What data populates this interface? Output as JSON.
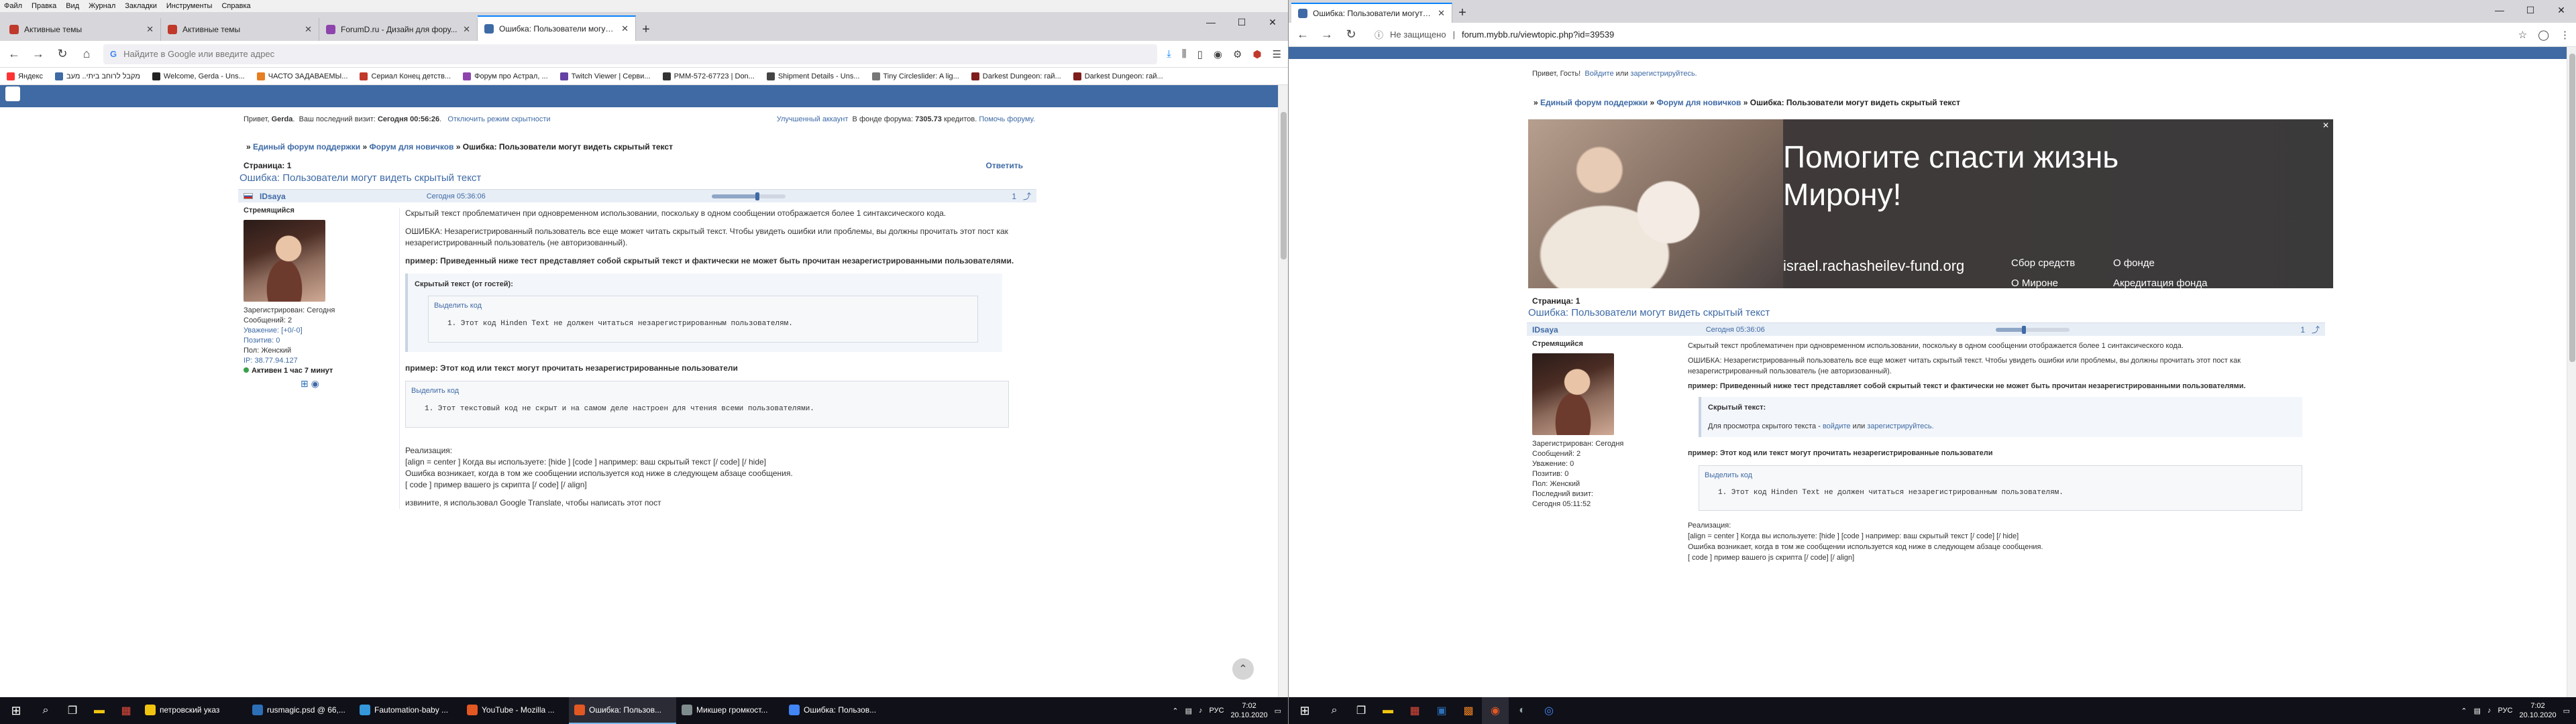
{
  "left": {
    "menu": [
      "Файл",
      "Правка",
      "Вид",
      "Журнал",
      "Закладки",
      "Инструменты",
      "Справка"
    ],
    "tabs": [
      {
        "label": "Активные темы",
        "color": "#c0392b",
        "active": false
      },
      {
        "label": "Активные темы",
        "color": "#c0392b",
        "active": false
      },
      {
        "label": "ForumD.ru - Дизайн для фору...",
        "color": "#8e44ad",
        "active": false
      },
      {
        "label": "Ошибка: Пользователи могут ...",
        "color": "#3e6aa5",
        "active": true
      }
    ],
    "url_placeholder": "Найдите в Google или введите адрес",
    "bookmarks": [
      {
        "label": "Яндекс",
        "color": "#ff3333"
      },
      {
        "label": "מקבל לרוחב ביתי.. מעב",
        "color": "#3e6aa5"
      },
      {
        "label": "Welcome, Gerda - Uns...",
        "color": "#222222"
      },
      {
        "label": "ЧАСТО ЗАДАВАЕМЫ...",
        "color": "#e67e22"
      },
      {
        "label": "Сериал Конец детств...",
        "color": "#c0392b"
      },
      {
        "label": "Форум про Астрал, ...",
        "color": "#8e44ad"
      },
      {
        "label": "Twitch Viewer | Серви...",
        "color": "#6441a5"
      },
      {
        "label": "PMM-572-67723 | Don...",
        "color": "#333333"
      },
      {
        "label": "Shipment Details - Uns...",
        "color": "#444444"
      },
      {
        "label": "Tiny Circleslider: A lig...",
        "color": "#777777"
      },
      {
        "label": "Darkest Dungeon: гай...",
        "color": "#7f1d1d"
      },
      {
        "label": "Darkest Dungeon: гай...",
        "color": "#7f1d1d"
      }
    ],
    "greeting": {
      "hello": "Привет,",
      "user": "Gerda",
      "last_visit_label": "Ваш последний визит:",
      "last_visit": "Сегодня 00:56:26",
      "disable_hidden": "Отключить режим скрытности",
      "account_label": "Улучшенный аккаунт",
      "fund_label": "В фонде форума:",
      "fund_value": "7305.73",
      "credits": "кредитов.",
      "help": "Помочь форуму."
    },
    "breadcrumbs": {
      "root": "Единый форум поддержки",
      "forum": "Форум для новичков",
      "current": "Ошибка: Пользователи могут видеть скрытый текст"
    },
    "pages_label": "Страница:",
    "pages_value": "1",
    "reply": "Ответить",
    "topic_title": "Ошибка: Пользователи могут видеть скрытый текст",
    "post": {
      "author": "IDsaya",
      "date": "Сегодня 05:36:06",
      "num": "1",
      "rating_fraction": 0.62,
      "rank": "Стремящийся",
      "registered": "Зарегистрирован: Сегодня",
      "messages": "Сообщений: 2",
      "respect": "Уважение: [+0/-0]",
      "positive": "Позитив: 0",
      "gender": "Пол: Женский",
      "ip": "IP: 38.77.94.127",
      "online": "Активен 1 час 7 минут",
      "p1": "Скрытый текст проблематичен при одновременном использовании, поскольку в одном сообщении отображается более 1 синтаксического кода.",
      "p2": "ОШИБКА: Незарегистрированный пользователь все еще может читать скрытый текст. Чтобы увидеть ошибки или проблемы, вы должны прочитать этот пост как незарегистрированный пользователь (не авторизованный).",
      "p3": "пример: Приведенный ниже тест представляет собой скрытый текст и фактически не может быть прочитан незарегистрированными пользователями.",
      "hidden_title": "Скрытый текст (от гостей):",
      "select_code": "Выделить код",
      "code1": "1.  Этот код Hinden Text не должен читаться незарегистрированным пользователям.",
      "p4": "пример: Этот код или текст могут прочитать незарегистрированные пользователи",
      "code2": "1.  Этот текстовый код не скрыт и на самом деле настроен для чтения всеми пользователями.",
      "impl": "Реализация:",
      "impl1": "[align = center ] Когда вы используете: [hide ] [code ] например: ваш скрытый текст [/ code] [/ hide]",
      "impl2": "Ошибка возникает, когда в том же сообщении используется код ниже в следующем абзаце сообщения.",
      "impl3": "[ code ] пример вашего js скрипта [/ code] [/ align]",
      "sorry": "извините, я использовал Google Translate, чтобы написать этот пост"
    },
    "taskbar": [
      {
        "label": "петровский указ",
        "color": "#f1c40f",
        "on": false
      },
      {
        "label": "rusmagic.psd @ 66,...",
        "color": "#2c6fb7",
        "on": false
      },
      {
        "label": "Fautomation-baby ...",
        "color": "#3498db",
        "on": false
      },
      {
        "label": "YouTube - Mozilla ...",
        "color": "#e25822",
        "on": false
      },
      {
        "label": "Ошибка: Пользов...",
        "color": "#e25822",
        "on": true
      },
      {
        "label": "Микшер громкост...",
        "color": "#7f8c8d",
        "on": false
      },
      {
        "label": "Ошибка: Пользов...",
        "color": "#4285f4",
        "on": false
      }
    ],
    "lang": "РУС",
    "time": "7:02",
    "date": "20.10.2020"
  },
  "right": {
    "tab_label": "Ошибка: Пользователи могут видеть скрытый текст",
    "not_secure": "Не защищено",
    "url": "forum.mybb.ru/viewtopic.php?id=39539",
    "greeting": {
      "hello": "Привет, Гость!",
      "login": "Войдите",
      "or": "или",
      "register": "зарегистрируйтесь."
    },
    "breadcrumbs": {
      "root": "Единый форум поддержки",
      "forum": "Форум для новичков",
      "current": "Ошибка: Пользователи могут видеть скрытый текст"
    },
    "banner": {
      "headline1": "Помогите спасти жизнь",
      "headline2": "Мирону!",
      "url": "israel.rachasheilev-fund.org",
      "b1": "Сбор средств",
      "b2": "О фонде",
      "b3": "О Мироне",
      "b4": "Акредитация фонда",
      "close": "✕"
    },
    "pages_label": "Страница:",
    "pages_value": "1",
    "topic_title": "Ошибка: Пользователи могут видеть скрытый текст",
    "post": {
      "author": "IDsaya",
      "date": "Сегодня 05:36:06",
      "num": "1",
      "rating_fraction": 0.38,
      "rank": "Стремящийся",
      "registered": "Зарегистрирован: Сегодня",
      "messages": "Сообщений: 2",
      "respect": "Уважение: 0",
      "positive": "Позитив: 0",
      "gender": "Пол: Женский",
      "last_visit": "Последний визит:",
      "last_visit_val": "Сегодня 05:11:52",
      "p1": "Скрытый текст проблематичен при одновременном использовании, поскольку в одном сообщении отображается более 1 синтаксического кода.",
      "p2": "ОШИБКА: Незарегистрированный пользователь все еще может читать скрытый текст. Чтобы увидеть ошибки или проблемы, вы должны прочитать этот пост как незарегистрированный пользователь (не авторизованный).",
      "p3": "пример: Приведенный ниже тест представляет собой скрытый текст и фактически не может быть прочитан незарегистрированными пользователями.",
      "hidden_title": "Скрытый текст:",
      "hidden_note": "Для просмотра скрытого текста -",
      "hidden_login": "войдите",
      "hidden_or": "или",
      "hidden_register": "зарегистрируйтесь.",
      "p4": "пример: Этот код или текст могут прочитать незарегистрированные пользователи",
      "select_code": "Выделить код",
      "code": "1.  Этот код Hinden Text не должен читаться незарегистрированным пользователям.",
      "impl": "Реализация:",
      "impl1": "[align = center ] Когда вы используете: [hide ] [code ] например: ваш скрытый текст [/ code] [/ hide]",
      "impl2": "Ошибка возникает, когда в том же сообщении используется код ниже в следующем абзаце сообщения.",
      "impl3": "[ code ] пример вашего js скрипта [/ code] [/ align]"
    },
    "lang": "РУС",
    "time": "7:02",
    "date": "20.10.2020"
  }
}
